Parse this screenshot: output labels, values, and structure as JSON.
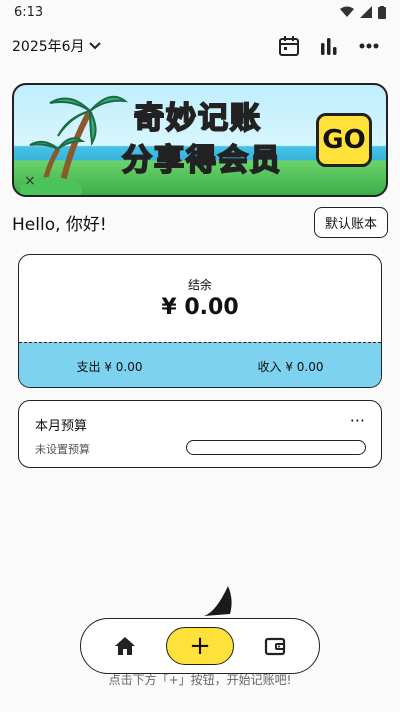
{
  "status_bar": {
    "time": "6:13"
  },
  "header": {
    "month": "2025年6月",
    "icons": [
      "calendar-icon",
      "bar-chart-icon",
      "more-icon"
    ]
  },
  "banner": {
    "line1": "奇妙记账",
    "line2": "分享得会员",
    "cta": "GO",
    "close": "×"
  },
  "greeting": "Hello, 你好!",
  "ledger_button": "默认账本",
  "summary": {
    "label": "结余",
    "balance": "¥ 0.00",
    "expense": "支出 ¥ 0.00",
    "income": "收入 ¥ 0.00"
  },
  "budget": {
    "title": "本月预算",
    "more": "···",
    "status": "未设置预算",
    "progress": 0
  },
  "hint": "点击下方「+」按钮，开始记账吧!",
  "nav": {
    "add_label": "+",
    "items": [
      "home-icon",
      "add-button",
      "wallet-icon"
    ]
  },
  "colors": {
    "accent_blue": "#7dd2ef",
    "accent_yellow": "#ffe13a",
    "title_pink": "#f26ab0"
  }
}
